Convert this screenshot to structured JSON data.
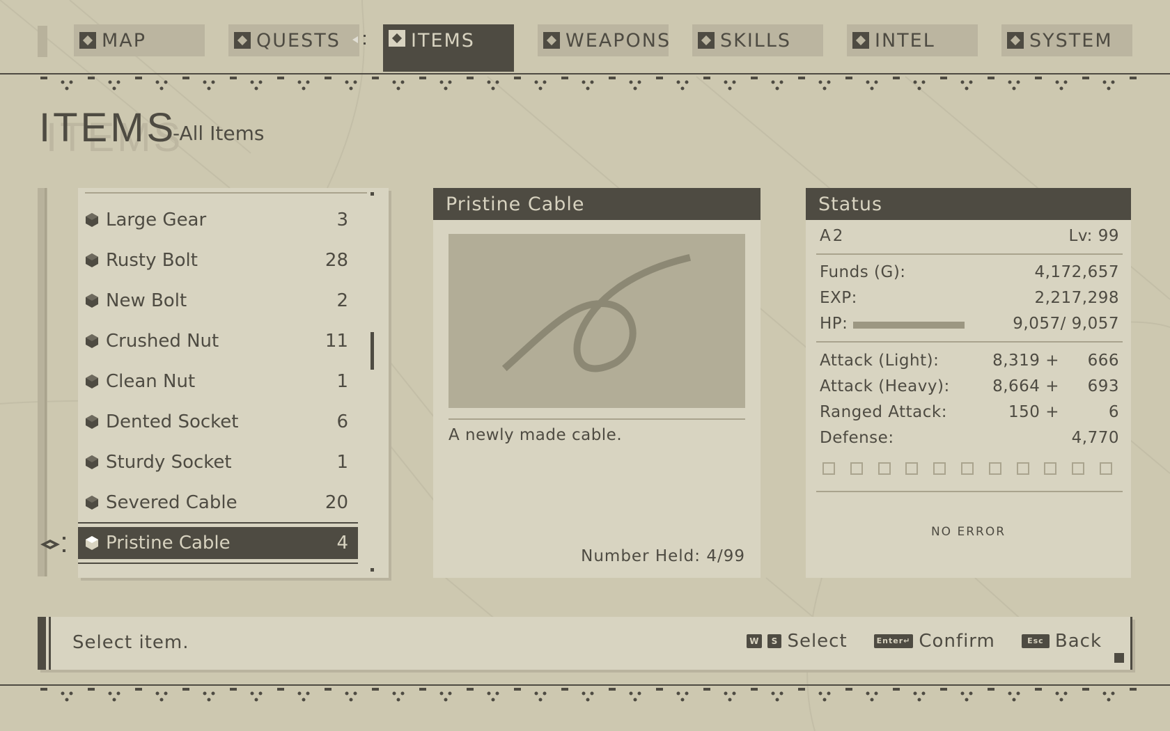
{
  "tabs": [
    {
      "label": "MAP",
      "icon": "map-icon"
    },
    {
      "label": "QUESTS",
      "icon": "quests-icon"
    },
    {
      "label": "ITEMS",
      "icon": "items-icon"
    },
    {
      "label": "WEAPONS",
      "icon": "weapons-icon"
    },
    {
      "label": "SKILLS",
      "icon": "skills-icon"
    },
    {
      "label": "INTEL",
      "icon": "intel-icon"
    },
    {
      "label": "SYSTEM",
      "icon": "system-icon"
    }
  ],
  "active_tab": "ITEMS",
  "page": {
    "title": "ITEMS",
    "subtitle": "-All Items"
  },
  "item_list": [
    {
      "name": "Large Gear",
      "count": "3"
    },
    {
      "name": "Rusty Bolt",
      "count": "28"
    },
    {
      "name": "New Bolt",
      "count": "2"
    },
    {
      "name": "Crushed Nut",
      "count": "11"
    },
    {
      "name": "Clean Nut",
      "count": "1"
    },
    {
      "name": "Dented Socket",
      "count": "6"
    },
    {
      "name": "Sturdy Socket",
      "count": "1"
    },
    {
      "name": "Severed Cable",
      "count": "20"
    },
    {
      "name": "Pristine Cable",
      "count": "4",
      "selected": true
    }
  ],
  "detail": {
    "title": "Pristine Cable",
    "description": "A newly made cable.",
    "number_held": "Number Held: 4/99"
  },
  "status": {
    "title": "Status",
    "name": "A2",
    "level": "Lv: 99",
    "funds_label": "Funds (G):",
    "funds": "4,172,657",
    "exp_label": "EXP:",
    "exp": "2,217,298",
    "hp_label": "HP:",
    "hp": "9,057/ 9,057",
    "hp_fraction": 1.0,
    "attack_light_label": "Attack (Light):",
    "attack_light": "8,319 +",
    "attack_light_bonus": "666",
    "attack_heavy_label": "Attack (Heavy):",
    "attack_heavy": "8,664 +",
    "attack_heavy_bonus": "693",
    "ranged_label": "Ranged Attack:",
    "ranged": "150 +",
    "ranged_bonus": "6",
    "defense_label": "Defense:",
    "defense": "4,770",
    "chip_slots": 11,
    "message": "NO ERROR"
  },
  "footer": {
    "help": "Select item.",
    "select_keys": [
      "W",
      "S"
    ],
    "select_label": "Select",
    "confirm_key": "Enter↵",
    "confirm_label": "Confirm",
    "back_key": "Esc",
    "back_label": "Back"
  },
  "colors": {
    "background": "#cdc8b0",
    "panel": "#d8d4c1",
    "dark": "#4e4b42",
    "muted": "#bbb5a0"
  }
}
